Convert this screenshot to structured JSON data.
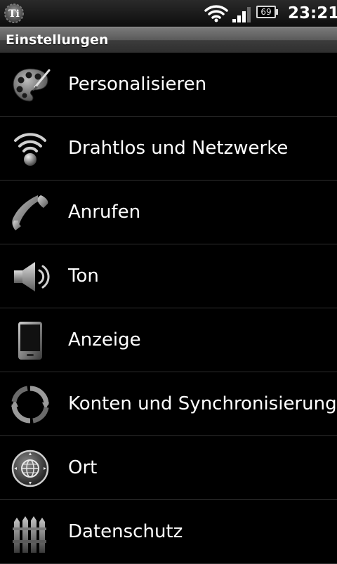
{
  "statusbar": {
    "notification_icon": "titanium-app-icon",
    "wifi_icon": "wifi-icon",
    "signal_icon": "signal-strength-icon",
    "battery_level": "69",
    "time": "23:21"
  },
  "titlebar": {
    "title": "Einstellungen"
  },
  "settings": {
    "items": [
      {
        "label": "Personalisieren",
        "icon": "palette-icon"
      },
      {
        "label": "Drahtlos und Netzwerke",
        "icon": "wireless-icon"
      },
      {
        "label": "Anrufen",
        "icon": "phone-handset-icon"
      },
      {
        "label": "Ton",
        "icon": "speaker-icon"
      },
      {
        "label": "Anzeige",
        "icon": "display-icon"
      },
      {
        "label": "Konten und Synchronisierung",
        "icon": "sync-icon"
      },
      {
        "label": "Ort",
        "icon": "location-globe-icon"
      },
      {
        "label": "Datenschutz",
        "icon": "privacy-fence-icon"
      }
    ]
  }
}
